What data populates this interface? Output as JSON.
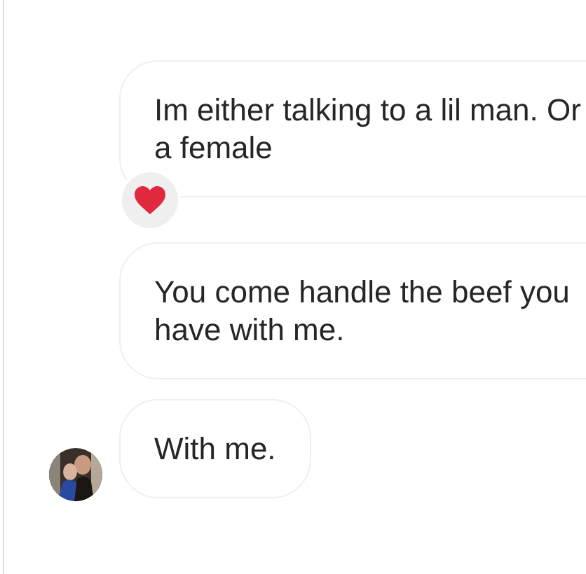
{
  "messages": [
    {
      "text": "Im either talking to a lil man. Or a female",
      "hearted": true,
      "show_avatar": false
    },
    {
      "text": "You come handle the beef you have with me.",
      "hearted": false,
      "show_avatar": false
    },
    {
      "text": "With me.",
      "hearted": false,
      "show_avatar": true
    }
  ]
}
